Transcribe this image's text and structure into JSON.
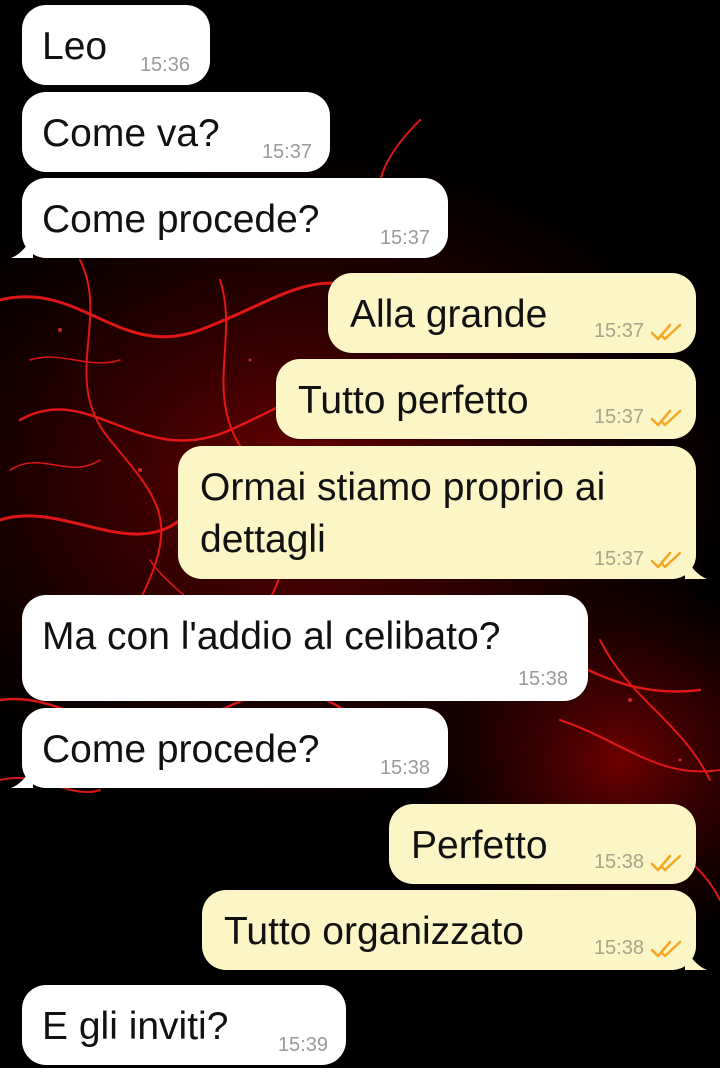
{
  "messages": [
    {
      "dir": "in",
      "text": "Leo",
      "time": "15:36"
    },
    {
      "dir": "in",
      "text": "Come va?",
      "time": "15:37"
    },
    {
      "dir": "in",
      "text": "Come procede?",
      "time": "15:37"
    },
    {
      "dir": "out",
      "text": "Alla grande",
      "time": "15:37"
    },
    {
      "dir": "out",
      "text": "Tutto perfetto",
      "time": "15:37"
    },
    {
      "dir": "out",
      "text": "Ormai stiamo proprio ai dettagli",
      "time": "15:37"
    },
    {
      "dir": "in",
      "text": "Ma con l'addio al celibato?",
      "time": "15:38"
    },
    {
      "dir": "in",
      "text": "Come procede?",
      "time": "15:38"
    },
    {
      "dir": "out",
      "text": "Perfetto",
      "time": "15:38"
    },
    {
      "dir": "out",
      "text": "Tutto organizzato",
      "time": "15:38"
    },
    {
      "dir": "in",
      "text": "E gli inviti?",
      "time": "15:39"
    }
  ],
  "colors": {
    "incoming_bubble": "#ffffff",
    "outgoing_bubble": "#fcf5c6",
    "read_ticks": "#f5a623",
    "wallpaper_base": "#000000",
    "wallpaper_accent": "#e01010"
  },
  "icons": {
    "read_receipt": "double-check-icon"
  }
}
